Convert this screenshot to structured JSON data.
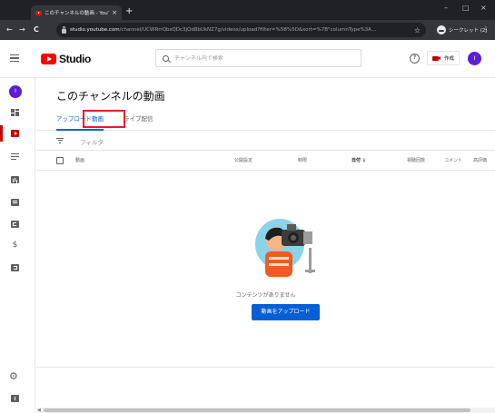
{
  "browser": {
    "tab_title": "このチャンネルの動画 - YouTube St...",
    "tab_close": "×",
    "new_tab": "+",
    "window_minimize": "–",
    "window_maximize": "□",
    "window_close": "×",
    "nav_back": "←",
    "nav_forward": "→",
    "nav_reload": "C",
    "url_host": "studio.youtube.com",
    "url_path": "/channel/UCWRrrQbsQDc3jQd8bUkNZ7g/videos/upload?filter=%5B%5D&sort=%7B\"columnType%3A...",
    "profile_label": "シークレット (2)",
    "menu": "⋮"
  },
  "header": {
    "logo_text": "Studio",
    "search_placeholder": "チャンネル内で検索",
    "help": "?",
    "create_label": "作成",
    "avatar_initial": "I"
  },
  "sidebar": {
    "channel_initial": "I",
    "items": [
      {
        "name": "dashboard",
        "active": false
      },
      {
        "name": "content",
        "active": true
      },
      {
        "name": "playlists",
        "active": false
      },
      {
        "name": "analytics",
        "active": false
      },
      {
        "name": "comments",
        "active": false
      },
      {
        "name": "subtitles",
        "active": false
      },
      {
        "name": "monetization",
        "active": false
      },
      {
        "name": "audio-library",
        "active": false
      }
    ],
    "dollar": "$",
    "gear": "⚙"
  },
  "main": {
    "title": "このチャンネルの動画",
    "tabs": {
      "uploads": "アップロード動画",
      "live": "ライブ配信"
    },
    "filter_label": "フィルタ",
    "columns": {
      "video": "動画",
      "visibility": "公開設定",
      "restrictions": "制限",
      "date": "日付 ↓",
      "views": "視聴回数",
      "comments": "コメント",
      "likes": "高評価"
    },
    "empty_text": "コンテンツがありません",
    "upload_button": "動画をアップロード"
  },
  "colors": {
    "accent_blue": "#065fd4",
    "youtube_red": "#ff0000",
    "highlight_red": "#e0202c"
  }
}
